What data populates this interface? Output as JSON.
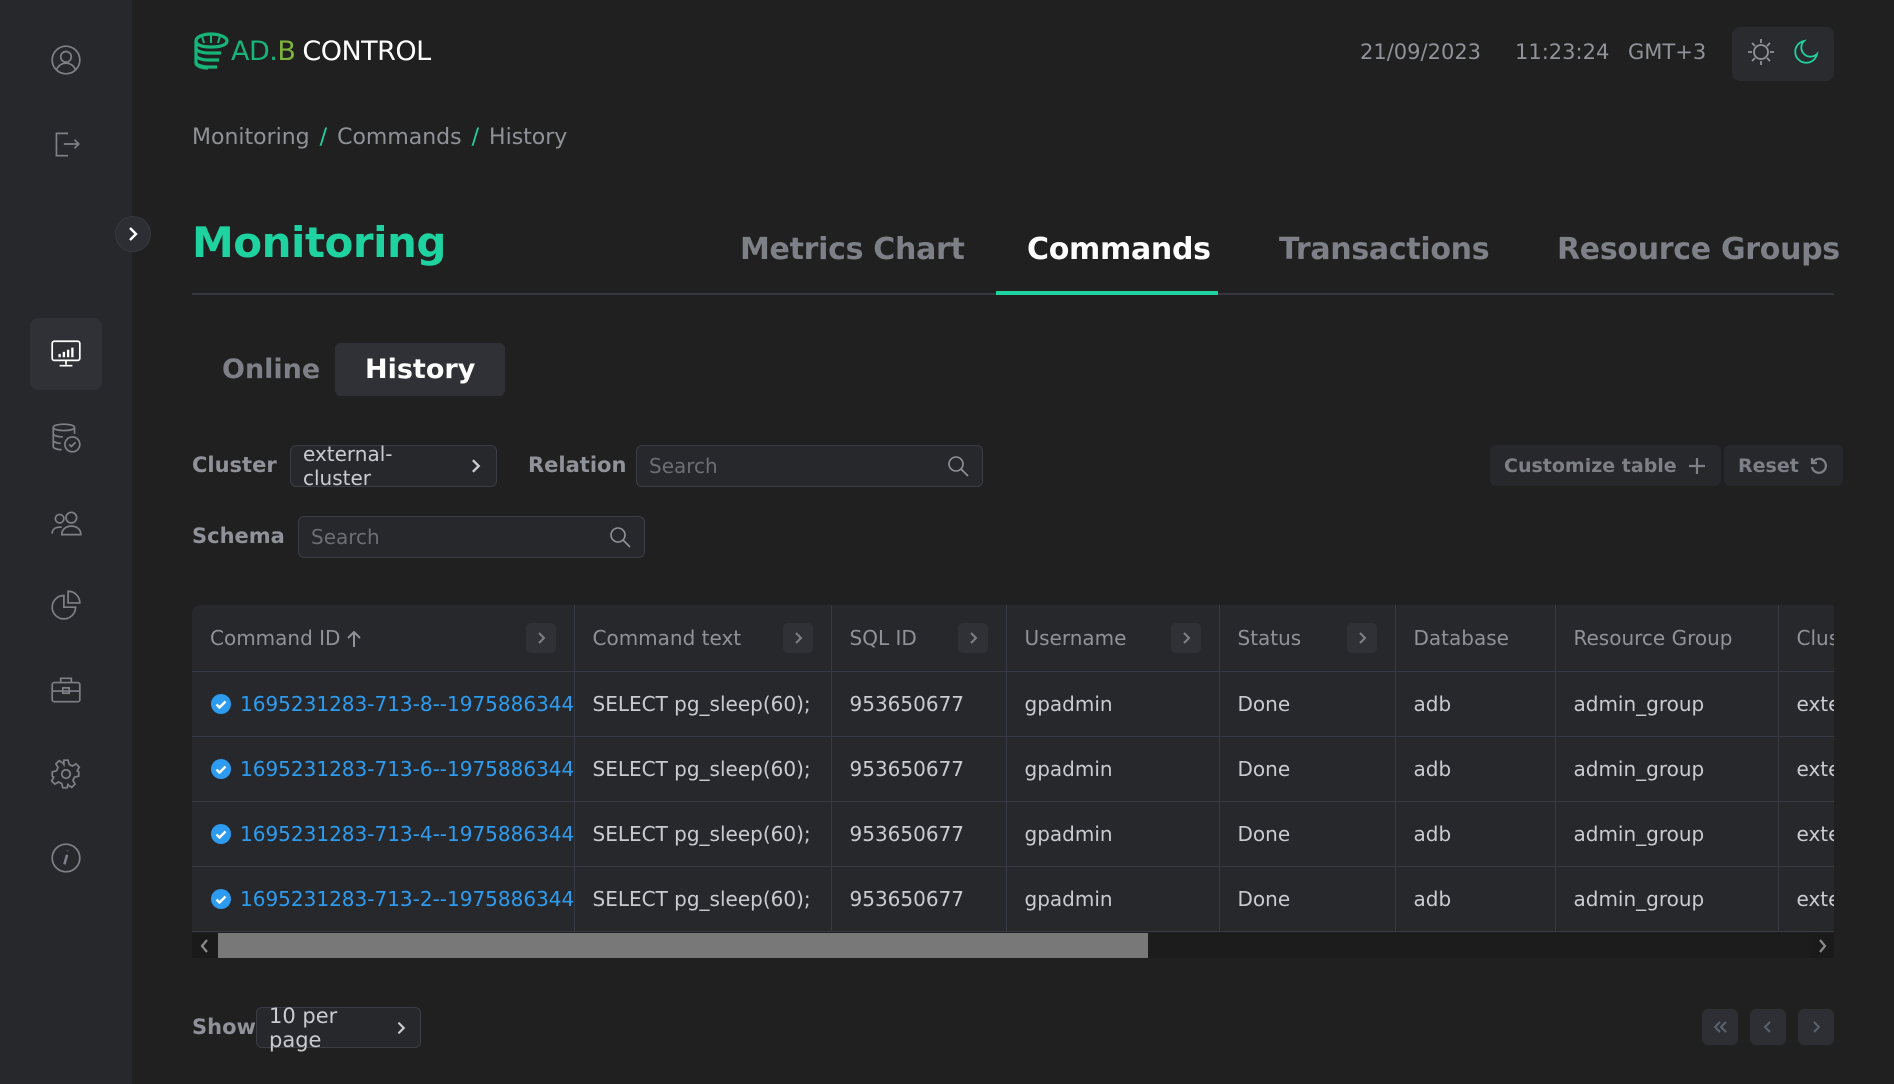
{
  "header": {
    "logo": {
      "part1": "AD.",
      "part2": "B",
      "part3": "CONTROL"
    },
    "date": "21/09/2023",
    "time": "11:23:24",
    "timezone": "GMT+3",
    "theme": {
      "light_icon": "sun-icon",
      "dark_icon": "moon-icon",
      "active": "dark"
    }
  },
  "sidebar": {
    "top_items": [
      {
        "icon": "user-profile-icon"
      },
      {
        "icon": "logout-icon"
      }
    ],
    "toggle_icon": "chevron-right-icon",
    "items": [
      {
        "icon": "monitoring-icon",
        "active": true
      },
      {
        "icon": "database-check-icon",
        "active": false
      },
      {
        "icon": "users-icon",
        "active": false
      },
      {
        "icon": "pie-chart-icon",
        "active": false
      },
      {
        "icon": "briefcase-icon",
        "active": false
      },
      {
        "icon": "settings-icon",
        "active": false
      },
      {
        "icon": "info-icon",
        "active": false
      }
    ]
  },
  "breadcrumb": [
    "Monitoring",
    "Commands",
    "History"
  ],
  "breadcrumb_separator": "/",
  "page": {
    "title": "Monitoring",
    "tabs": [
      {
        "label": "Metrics Chart",
        "active": false
      },
      {
        "label": "Commands",
        "active": true
      },
      {
        "label": "Transactions",
        "active": false
      },
      {
        "label": "Resource Groups",
        "active": false
      }
    ],
    "subtabs": [
      {
        "label": "Online",
        "active": false
      },
      {
        "label": "History",
        "active": true
      }
    ]
  },
  "filters": {
    "cluster": {
      "label": "Cluster",
      "value": "external-cluster"
    },
    "relation": {
      "label": "Relation",
      "placeholder": "Search",
      "value": ""
    },
    "schema": {
      "label": "Schema",
      "placeholder": "Search",
      "value": ""
    },
    "customize_label": "Customize table",
    "reset_label": "Reset"
  },
  "table": {
    "columns": [
      {
        "label": "Command ID",
        "sorted": "asc",
        "expandable": true
      },
      {
        "label": "Command text",
        "expandable": true
      },
      {
        "label": "SQL ID",
        "expandable": true
      },
      {
        "label": "Username",
        "expandable": true
      },
      {
        "label": "Status",
        "expandable": true
      },
      {
        "label": "Database",
        "expandable": false
      },
      {
        "label": "Resource Group",
        "expandable": false
      },
      {
        "label": "Clus",
        "expandable": false
      }
    ],
    "rows": [
      {
        "command_id": "1695231283-713-8--1975886344",
        "command_text": "SELECT pg_sleep(60);",
        "sql_id": "953650677",
        "username": "gpadmin",
        "status": "Done",
        "database": "adb",
        "resource_group": "admin_group",
        "cluster": "exte"
      },
      {
        "command_id": "1695231283-713-6--1975886344",
        "command_text": "SELECT pg_sleep(60);",
        "sql_id": "953650677",
        "username": "gpadmin",
        "status": "Done",
        "database": "adb",
        "resource_group": "admin_group",
        "cluster": "exte"
      },
      {
        "command_id": "1695231283-713-4--1975886344",
        "command_text": "SELECT pg_sleep(60);",
        "sql_id": "953650677",
        "username": "gpadmin",
        "status": "Done",
        "database": "adb",
        "resource_group": "admin_group",
        "cluster": "exte"
      },
      {
        "command_id": "1695231283-713-2--1975886344",
        "command_text": "SELECT pg_sleep(60);",
        "sql_id": "953650677",
        "username": "gpadmin",
        "status": "Done",
        "database": "adb",
        "resource_group": "admin_group",
        "cluster": "exte"
      }
    ],
    "horizontal_scroll_fraction": 0.0
  },
  "footer": {
    "show_label": "Show",
    "per_page": "10 per page",
    "pager": [
      "first-page-icon",
      "prev-page-icon",
      "next-page-icon"
    ]
  },
  "colors": {
    "accent": "#1ed3a0",
    "link": "#2d9cf0",
    "logo_green": "#17b57a",
    "logo_lime": "#7db33c",
    "background": "#202020",
    "sidebar": "#27282c"
  }
}
